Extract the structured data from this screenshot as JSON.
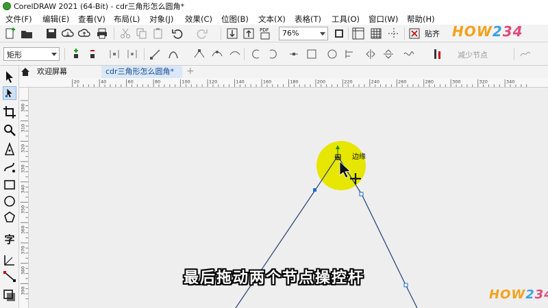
{
  "window": {
    "title": "CorelDRAW 2021 (64-Bit) - cdr三角形怎么圆角*"
  },
  "menu": {
    "items": [
      "文件(F)",
      "编辑(E)",
      "查看(V)",
      "布局(L)",
      "对象(J)",
      "效果(C)",
      "位图(B)",
      "文本(X)",
      "表格(T)",
      "工具(O)",
      "窗口(W)",
      "帮助(H)"
    ]
  },
  "toolbar": {
    "zoom_value": "76%",
    "snap_label": "贴齐",
    "pdf_label": "PDF"
  },
  "property_bar": {
    "shape_type": "矩形",
    "reduce_nodes_label": "减少节点"
  },
  "tabs": {
    "welcome": "欢迎屏幕",
    "document": "cdr三角形怎么圆角*",
    "add": "+"
  },
  "ruler": {
    "h_ticks": [
      "20",
      "40",
      "60",
      "80",
      "100",
      "120",
      "140",
      "160",
      "180",
      "200",
      "220",
      "240",
      "260",
      "280",
      "300",
      "320",
      "340"
    ],
    "v_ticks": [
      "300",
      "310",
      "320",
      "330",
      "340",
      "350",
      "360",
      "370",
      "380",
      "390"
    ]
  },
  "canvas": {
    "node_tooltip": "边缘",
    "highlight_color": "#e6e600",
    "line_color": "#2b4a7a"
  },
  "subtitle": "最后拖动两个节点操控杆",
  "watermark": {
    "parts": [
      "HOW",
      "2",
      "34"
    ]
  },
  "colors": {
    "tab_active_bg": "#d9e7f7",
    "tab_active_text": "#1b4d8f"
  }
}
